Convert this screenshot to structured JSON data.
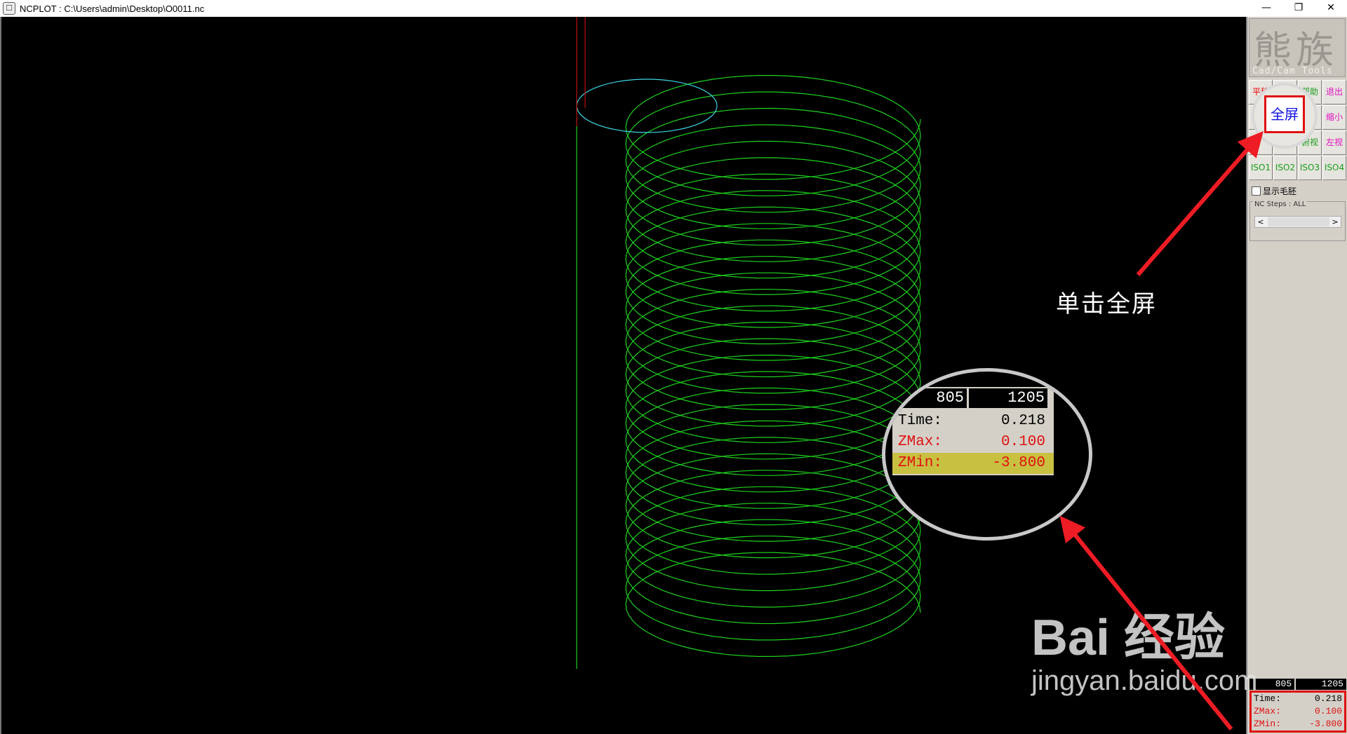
{
  "window": {
    "title": "NCPLOT : C:\\Users\\admin\\Desktop\\O0011.nc",
    "minimize": "—",
    "restore": "❐",
    "close": "✕"
  },
  "panel": {
    "logo_glyphs": "熊族",
    "logo_sub": "Cad/Cam Tools",
    "buttons": [
      {
        "label": "平移",
        "color": "red"
      },
      {
        "label": "",
        "color": "green"
      },
      {
        "label": "帮助",
        "color": "green"
      },
      {
        "label": "退出",
        "color": "magenta"
      },
      {
        "label": "",
        "color": "red"
      },
      {
        "label": "全屏",
        "color": "green"
      },
      {
        "label": "",
        "color": "green"
      },
      {
        "label": "缩小",
        "color": "magenta"
      },
      {
        "label": "",
        "color": "green"
      },
      {
        "label": "",
        "color": "green"
      },
      {
        "label": "俯视",
        "color": "green"
      },
      {
        "label": "左视",
        "color": "magenta"
      },
      {
        "label": "ISO1",
        "color": "green"
      },
      {
        "label": "ISO2",
        "color": "green"
      },
      {
        "label": "ISO3",
        "color": "green"
      },
      {
        "label": "ISO4",
        "color": "green"
      }
    ],
    "show_blank_label": "显示毛胚",
    "nc_steps_label": "NC Steps : ALL",
    "scroll_left": "<",
    "scroll_right": ">"
  },
  "readout": {
    "val1": "805",
    "val2": "1205",
    "time_label": "Time:",
    "time_value": "0.218",
    "zmax_label": "ZMax:",
    "zmax_value": "0.100",
    "zmin_label": "ZMin:",
    "zmin_value": "-3.800"
  },
  "annotation": {
    "callout_button": "全屏",
    "callout_text": "单击全屏",
    "arrow_color": "#ee1c24"
  },
  "watermark": {
    "main": "Bai  经验",
    "sub": "jingyan.baidu.com"
  },
  "colors": {
    "toolpath": "#1fd21f",
    "current": "#3fd8e8",
    "spindle": "#c01010",
    "background": "#000000"
  }
}
